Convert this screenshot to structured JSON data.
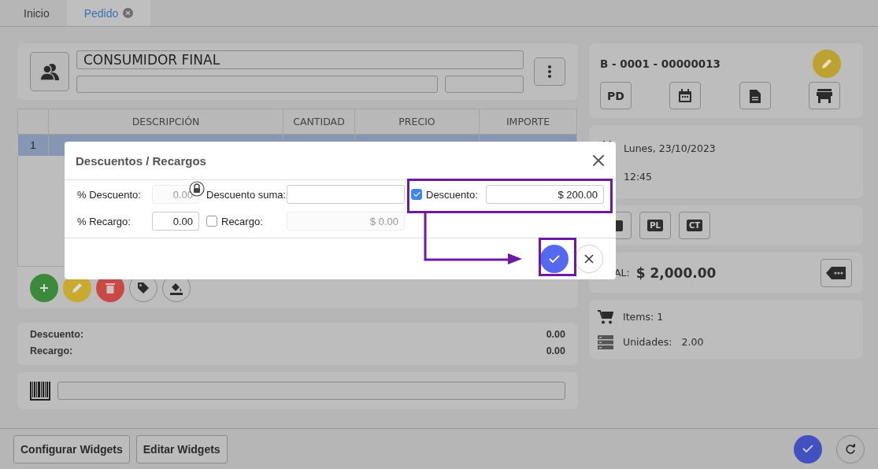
{
  "tabs": [
    {
      "label": "Inicio",
      "selected": false,
      "closable": false
    },
    {
      "label": "Pedido",
      "selected": true,
      "closable": true
    }
  ],
  "customer": {
    "name": "CONSUMIDOR FINAL"
  },
  "table": {
    "columns": [
      "DESCRIPCIÓN",
      "CANTIDAD",
      "PRECIO",
      "IMPORTE"
    ],
    "rows": [
      {
        "cells": [
          "1"
        ],
        "selected": true
      }
    ]
  },
  "row_actions": [
    {
      "kind": "add"
    },
    {
      "kind": "edit"
    },
    {
      "kind": "delete"
    },
    {
      "kind": "tag"
    },
    {
      "kind": "fill"
    }
  ],
  "totals": [
    {
      "label": "Descuento:",
      "value": "0.00"
    },
    {
      "label": "Recargo:",
      "value": "0.00"
    }
  ],
  "document": {
    "number": "B - 0001 - 00000013",
    "type_code": "PD"
  },
  "date": "Lunes, 23/10/2023",
  "time": "12:45",
  "codes": [
    "PL",
    "CT"
  ],
  "total": {
    "label": "AL:",
    "value": "$ 2,000.00"
  },
  "summary": {
    "items": "Items: 1",
    "units_label": "Unidades:",
    "units": "2.00"
  },
  "footer": {
    "buttons": [
      "Configurar Widgets",
      "Editar Widgets"
    ]
  },
  "modal": {
    "title": "Descuentos / Recargos",
    "fields": [
      {
        "kind": "input",
        "label": "% Descuento:",
        "value": "0.00",
        "disabled": true,
        "locked": true
      },
      {
        "kind": "input",
        "label": "Descuento suma:",
        "disabled": false
      },
      {
        "kind": "check",
        "label": "Descuento:",
        "checked": true,
        "value": "$ 200.00",
        "disabled": false
      },
      {
        "kind": "input",
        "label": "% Recargo:",
        "value": "0.00",
        "disabled": false
      },
      {
        "kind": "check",
        "label": "Recargo:",
        "checked": false,
        "value": "$ 0.00",
        "disabled": true
      }
    ]
  }
}
